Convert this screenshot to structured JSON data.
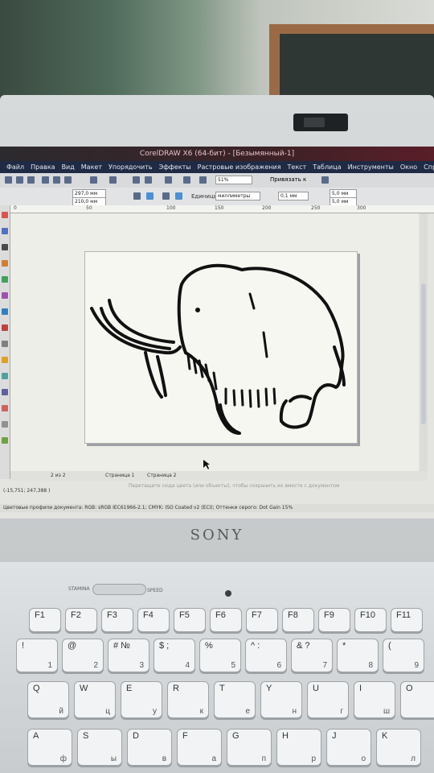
{
  "app": {
    "title": "CorelDRAW X6 (64-бит) - [Безымянный-1]",
    "menu": [
      "Файл",
      "Правка",
      "Вид",
      "Макет",
      "Упорядочить",
      "Эффекты",
      "Растровые изображения",
      "Текст",
      "Таблица",
      "Инструменты",
      "Окно",
      "Справка"
    ],
    "width_field": "297,0 мм",
    "height_field": "210,0 мм",
    "zoom": "51%",
    "snap_label": "Привязать к",
    "units_label": "Единицы:",
    "units_value": "миллиметры",
    "nudge": "0,1 мм",
    "dup_x": "5,0 мм",
    "dup_y": "5,0 мм",
    "ruler_ticks": [
      "0",
      "50",
      "100",
      "150",
      "200",
      "250",
      "300"
    ],
    "page_count": "2 из 2",
    "page_tabs": [
      "Страница 1",
      "Страница 2"
    ],
    "hint": "Перетащите сюда цвета (или объекты), чтобы сохранить их вместе с документом",
    "coords": "(-15,751; 247,388 )",
    "status": "Цветовые профили документа: RGB: sRGB IEC61966-2.1; CMYK: ISO Coated v2 (ECI); Оттенки серого: Dot Gain 15%"
  },
  "laptop": {
    "brand": "SONY",
    "stamina": "STAMINA",
    "speed": "SPEED",
    "keys_fn": [
      "F1",
      "F2",
      "F3",
      "F4",
      "F5",
      "F6",
      "F7",
      "F8",
      "F9",
      "F10",
      "F11"
    ],
    "keys_num": [
      {
        "p": "!",
        "s": "1"
      },
      {
        "p": "@",
        "s": "2"
      },
      {
        "p": "#  №",
        "s": "3"
      },
      {
        "p": "$  ;",
        "s": "4"
      },
      {
        "p": "%",
        "s": "5"
      },
      {
        "p": "^  :",
        "s": "6"
      },
      {
        "p": "&  ?",
        "s": "7"
      },
      {
        "p": "*",
        "s": "8"
      },
      {
        "p": "(",
        "s": "9"
      }
    ],
    "keys_q": [
      {
        "p": "Q",
        "s": "й"
      },
      {
        "p": "W",
        "s": "ц"
      },
      {
        "p": "E",
        "s": "у"
      },
      {
        "p": "R",
        "s": "к"
      },
      {
        "p": "T",
        "s": "е"
      },
      {
        "p": "Y",
        "s": "н"
      },
      {
        "p": "U",
        "s": "г"
      },
      {
        "p": "I",
        "s": "ш"
      },
      {
        "p": "O",
        "s": ""
      }
    ],
    "keys_a": [
      {
        "p": "A",
        "s": "ф"
      },
      {
        "p": "S",
        "s": "ы"
      },
      {
        "p": "D",
        "s": "в"
      },
      {
        "p": "F",
        "s": "а"
      },
      {
        "p": "G",
        "s": "п"
      },
      {
        "p": "H",
        "s": "р"
      },
      {
        "p": "J",
        "s": "о"
      },
      {
        "p": "K",
        "s": "л"
      }
    ]
  },
  "colors": {
    "menubar": "#1f2a45",
    "titlebar": "#5a1e28",
    "drawing": "#111111"
  }
}
